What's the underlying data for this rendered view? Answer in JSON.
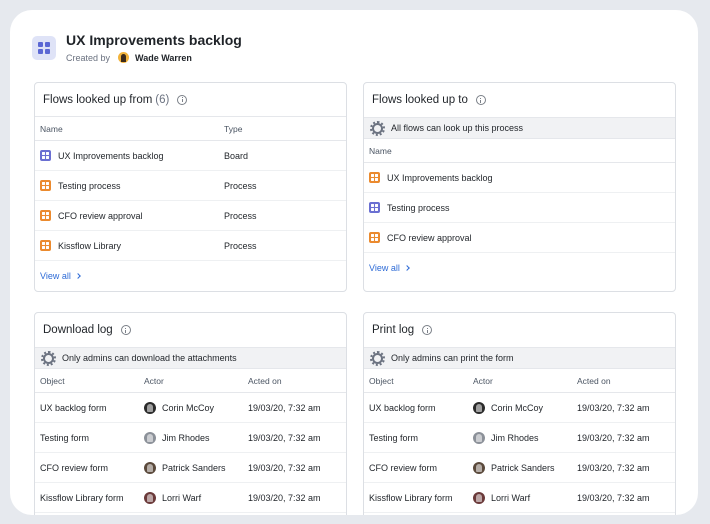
{
  "header": {
    "title": "UX Improvements backlog",
    "created_by_label": "Created by",
    "creator": "Wade Warren"
  },
  "flows_from": {
    "title": "Flows looked up from",
    "count": "(6)",
    "columns": {
      "name": "Name",
      "type": "Type"
    },
    "rows": [
      {
        "name": "UX Improvements backlog",
        "type": "Board",
        "icon": "board-icon"
      },
      {
        "name": "Testing process",
        "type": "Process",
        "icon": "process-icon"
      },
      {
        "name": "CFO review approval",
        "type": "Process",
        "icon": "process-icon"
      },
      {
        "name": "Kissflow Library",
        "type": "Process",
        "icon": "process-icon"
      }
    ],
    "view_all": "View all"
  },
  "flows_to": {
    "title": "Flows looked up to",
    "notice": "All flows can look up this process",
    "columns": {
      "name": "Name"
    },
    "rows": [
      {
        "name": "UX Improvements backlog",
        "icon": "process-icon"
      },
      {
        "name": "Testing process",
        "icon": "board-icon"
      },
      {
        "name": "CFO review approval",
        "icon": "process-icon"
      }
    ],
    "view_all": "View all"
  },
  "download_log": {
    "title": "Download log",
    "notice": "Only admins can download the attachments",
    "columns": {
      "object": "Object",
      "actor": "Actor",
      "acted_on": "Acted on"
    },
    "rows": [
      {
        "object": "UX backlog form",
        "actor": "Corin McCoy",
        "acted_on": "19/03/20, 7:32 am"
      },
      {
        "object": "Testing form",
        "actor": "Jim Rhodes",
        "acted_on": "19/03/20, 7:32 am"
      },
      {
        "object": "CFO review form",
        "actor": "Patrick Sanders",
        "acted_on": "19/03/20, 7:32 am"
      },
      {
        "object": "Kissflow Library form",
        "actor": "Lorri Warf",
        "acted_on": "19/03/20, 7:32 am"
      }
    ]
  },
  "print_log": {
    "title": "Print log",
    "notice": "Only admins can print the form",
    "columns": {
      "object": "Object",
      "actor": "Actor",
      "acted_on": "Acted on"
    },
    "rows": [
      {
        "object": "UX backlog form",
        "actor": "Corin McCoy",
        "acted_on": "19/03/20, 7:32 am"
      },
      {
        "object": "Testing form",
        "actor": "Jim Rhodes",
        "acted_on": "19/03/20, 7:32 am"
      },
      {
        "object": "CFO review form",
        "actor": "Patrick Sanders",
        "acted_on": "19/03/20, 7:32 am"
      },
      {
        "object": "Kissflow Library form",
        "actor": "Lorri Warf",
        "acted_on": "19/03/20, 7:32 am"
      }
    ]
  },
  "colors": {
    "board": "#6a6fd2",
    "process": "#eb8a2e",
    "link": "#2e6bd6",
    "avatars": [
      "#2b2b2b",
      "#8c9199",
      "#5b4a3c",
      "#6b3a3a"
    ]
  }
}
